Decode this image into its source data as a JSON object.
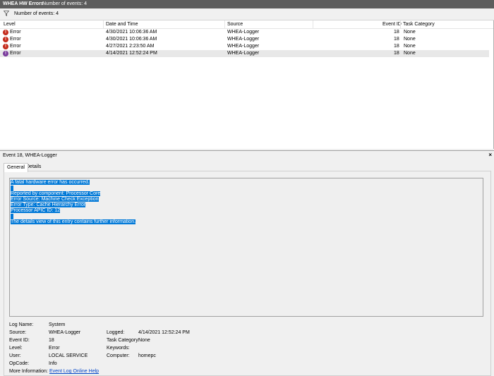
{
  "title": {
    "view_name": "WHEA HW Errors",
    "count": "Number of events: 4"
  },
  "toolbar": {
    "count": "Number of events: 4",
    "filter_icon": "filter-icon"
  },
  "columns": {
    "level": "Level",
    "date": "Date and Time",
    "source": "Source",
    "event_id": "Event ID",
    "task": "Task Category"
  },
  "rows": [
    {
      "level": "Error",
      "date": "4/30/2021 10:06:36 AM",
      "source": "WHEA-Logger",
      "event_id": "18",
      "task": "None"
    },
    {
      "level": "Error",
      "date": "4/30/2021 10:06:36 AM",
      "source": "WHEA-Logger",
      "event_id": "18",
      "task": "None"
    },
    {
      "level": "Error",
      "date": "4/27/2021 2:23:50 AM",
      "source": "WHEA-Logger",
      "event_id": "18",
      "task": "None"
    },
    {
      "level": "Error",
      "date": "4/14/2021 12:52:24 PM",
      "source": "WHEA-Logger",
      "event_id": "18",
      "task": "None"
    }
  ],
  "selected_row": 3,
  "panel": {
    "title": "Event 18, WHEA-Logger",
    "close": "×"
  },
  "tabs": {
    "general": "General",
    "details": "Details"
  },
  "description": {
    "line1": "A fatal hardware error has occurred.",
    "line2": "Reported by component: Processor Core",
    "line3": "Error Source: Machine Check Exception",
    "line4": "Error Type: Cache Hierarchy Error",
    "line5": "Processor APIC ID: 12",
    "line6": "The details view of this entry contains further information."
  },
  "props": {
    "log_name_label": "Log Name:",
    "log_name": "System",
    "source_label": "Source:",
    "source": "WHEA-Logger",
    "logged_label": "Logged:",
    "logged": "4/14/2021 12:52:24 PM",
    "event_id_label": "Event ID:",
    "event_id": "18",
    "task_label": "Task Category:",
    "task": "None",
    "level_label": "Level:",
    "level": "Error",
    "keywords_label": "Keywords:",
    "user_label": "User:",
    "user": "LOCAL SERVICE",
    "computer_label": "Computer:",
    "computer": "homepc",
    "opcode_label": "OpCode:",
    "opcode": "Info",
    "more_info_label": "More Information:",
    "more_info_link": "Event Log Online Help"
  },
  "colors": {
    "selection": "#0078d7",
    "error_icon": "#c42b1c",
    "titlebar": "#5d5d5d"
  }
}
